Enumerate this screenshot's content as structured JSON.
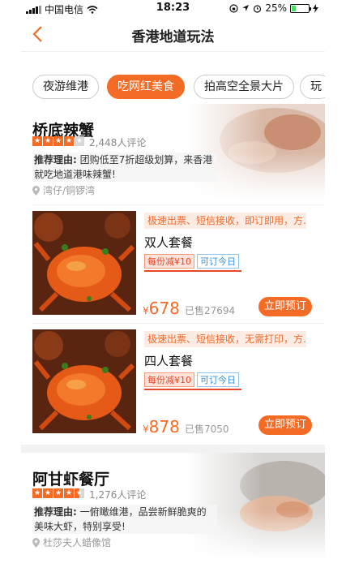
{
  "status_bar": {
    "carrier": "中国电信",
    "time": "18:23",
    "battery": "25%",
    "battery_level": 0.25
  },
  "nav": {
    "title": "香港地道玩法"
  },
  "tabs": [
    {
      "label": "夜游维港",
      "active": false
    },
    {
      "label": "吃网红美食",
      "active": true
    },
    {
      "label": "拍高空全景大片",
      "active": false
    },
    {
      "label": "玩",
      "active": false
    }
  ],
  "restaurants": [
    {
      "name": "桥底辣蟹",
      "rating": 4,
      "reviews": "2,448人评论",
      "reason_label": "推荐理由:",
      "reason": "团购低至7折超级划算，来香港就吃地道港味辣蟹!",
      "location": "湾仔/铜锣湾",
      "deals": [
        {
          "tagline": "极速出票、短信接收，即订即用，方...",
          "name": "双人套餐",
          "discount": "每份减¥10",
          "avail": "可订今日",
          "currency": "¥",
          "price": "678",
          "sold": "已售27694",
          "button": "立即预订"
        },
        {
          "tagline": "极速出票、短信接收，无需打印，方...",
          "name": "四人套餐",
          "discount": "每份减¥10",
          "avail": "可订今日",
          "currency": "¥",
          "price": "878",
          "sold": "已售7050",
          "button": "立即预订"
        }
      ]
    },
    {
      "name": "阿甘虾餐厅",
      "rating": 4.5,
      "reviews": "1,276人评论",
      "reason_label": "推荐理由:",
      "reason": "一俯瞰维港，品尝新鲜脆爽的美味大虾，特别享受!",
      "location": "杜莎夫人蜡像馆"
    }
  ],
  "colors": {
    "accent": "#f46b25",
    "discount_red": "#e8452a",
    "avail_blue": "#3a8fd2"
  }
}
